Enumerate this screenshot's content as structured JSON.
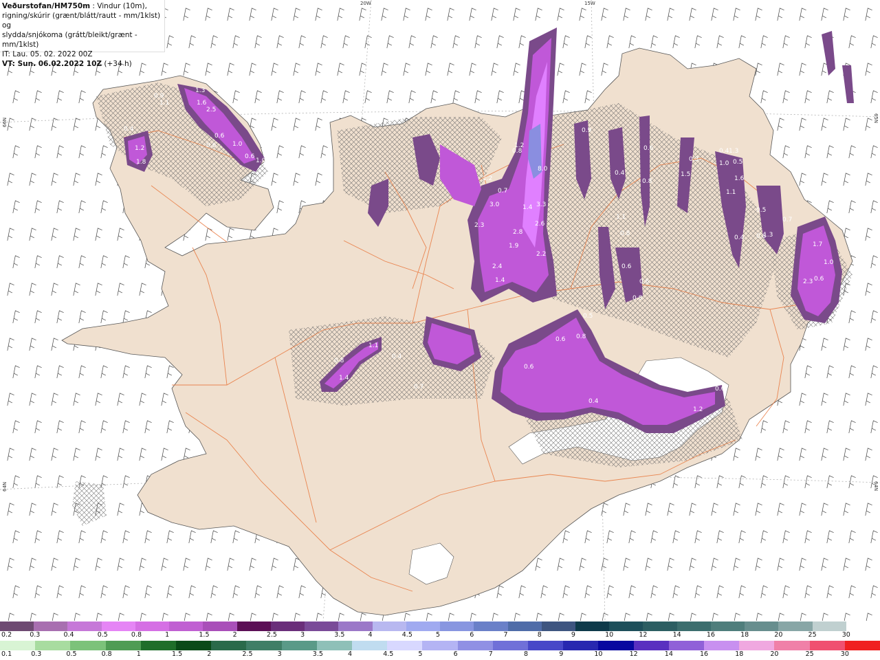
{
  "title": {
    "agency": "Veðurstofan/HM750m",
    "desc_line1": " : Vindur (10m),",
    "desc_line2": "rigning/skúrir (grænt/blátt/rautt - mm/1klst) og",
    "desc_line3": "slydda/snjókoma (grátt/bleikt/grænt - mm/1klst)",
    "init_time": "IT: Lau. 05. 02. 2022 00Z",
    "valid_prefix": "VT: Sun. 06.02.2022 10Z",
    "valid_suffix": " (+34 h)"
  },
  "graticule": {
    "lon_top": [
      "20W",
      "15W"
    ],
    "lat_left": [
      "66N",
      "64N"
    ],
    "lat_right": [
      "65N",
      "64N"
    ]
  },
  "map_labels": [
    "1.3",
    "1.6",
    "2.5",
    "0.9",
    "1.1",
    "1.0",
    "0.6",
    "1.0",
    "1.2",
    "1.8",
    "0.8",
    "0.6",
    "0.6",
    "0.4",
    "3.0",
    "2.3",
    "2.8",
    "1.9",
    "1.4",
    "2.2",
    "2.6",
    "3.3",
    "8.0",
    "2.4",
    "1.2",
    "0.7",
    "0.8",
    "1.2",
    "1.4",
    "0.9",
    "0.6",
    "0.8",
    "0.3",
    "1.5",
    "1.6",
    "0.5",
    "0.4",
    "1.1",
    "0.8",
    "1.3",
    "1.7",
    "1.0",
    "0.6",
    "2.3",
    "0.5",
    "0.8",
    "0.4",
    "0.7",
    "1.1",
    "1.3",
    "1.0",
    "0.4",
    "0.6",
    "0.6",
    "0.8",
    "1.1",
    "1.4",
    "0.4",
    "0.8",
    "0.7",
    "0.5",
    "0.6",
    "0.6",
    "0.8",
    "0.4",
    "1.2",
    "0.6"
  ],
  "colors": {
    "land": "#f0e0cf",
    "sea": "#ffffff",
    "roads": "#e8753a",
    "precip_light": "#7a4a8a",
    "precip_mid": "#c058d8",
    "precip_heavy": "#e080ff",
    "precip_blue": "#8a8ee0"
  },
  "legend_snow": {
    "labels": [
      "0.2",
      "0.3",
      "0.4",
      "0.5",
      "0.8",
      "1",
      "1.5",
      "2",
      "2.5",
      "3",
      "3.5",
      "4",
      "4.5",
      "5",
      "6",
      "7",
      "8",
      "9",
      "10",
      "12",
      "14",
      "16",
      "18",
      "20",
      "25",
      "30"
    ],
    "colors": [
      "#6e4a72",
      "#a86fb0",
      "#c678d8",
      "#e585f5",
      "#d56fe4",
      "#c060d2",
      "#a94fb9",
      "#5b0f55",
      "#6a2e7a",
      "#7a4a98",
      "#9b78c8",
      "#b8b8f0",
      "#a0aaf0",
      "#8896e0",
      "#6a80c8",
      "#4f6ca8",
      "#3e5580",
      "#0e3a4a",
      "#1d4f5a",
      "#2c5e62",
      "#3c6e6e",
      "#4f7e7c",
      "#678e8e",
      "#88a6a6",
      "#c0d0d0",
      "#ffffff"
    ]
  },
  "legend_rain": {
    "labels": [
      "0.1",
      "0.3",
      "0.5",
      "0.8",
      "1",
      "1.5",
      "2",
      "2.5",
      "3",
      "3.5",
      "4",
      "4.5",
      "5",
      "6",
      "7",
      "8",
      "9",
      "10",
      "12",
      "14",
      "16",
      "18",
      "20",
      "25",
      "30"
    ],
    "colors": [
      "#d8f4d4",
      "#a8dca0",
      "#7cc27a",
      "#4f9c54",
      "#1f6e2a",
      "#0a4a18",
      "#2a6a4a",
      "#3f7e66",
      "#5a9a88",
      "#8ec0b8",
      "#c0dcf0",
      "#d8d8ff",
      "#b4b4f4",
      "#9090e4",
      "#7070d8",
      "#4848c8",
      "#2828b0",
      "#0808a0",
      "#5a30c0",
      "#9060d8",
      "#c890f0",
      "#f0a8e0",
      "#f080a8",
      "#f05070",
      "#f02020"
    ]
  }
}
